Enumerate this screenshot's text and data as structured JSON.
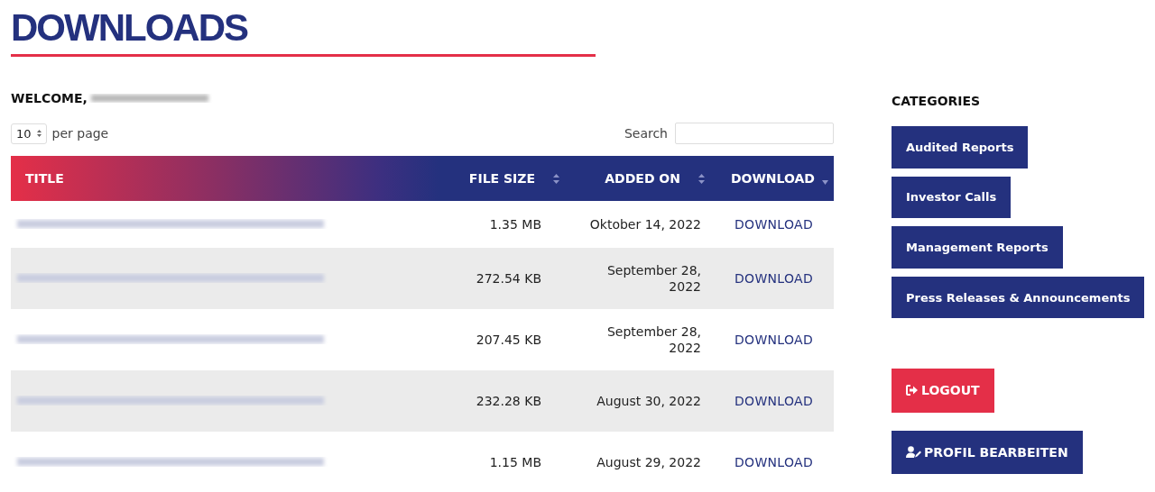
{
  "page_title": "DOWNLOADS",
  "welcome": {
    "label": "WELCOME,",
    "name_redacted": true
  },
  "per_page": {
    "value": "10",
    "label": "per page"
  },
  "search": {
    "label": "Search"
  },
  "table": {
    "columns": [
      {
        "label": "TITLE",
        "sortable": false,
        "sorted_desc": false
      },
      {
        "label": "FILE SIZE",
        "sortable": true,
        "sorted_desc": false
      },
      {
        "label": "ADDED ON",
        "sortable": true,
        "sorted_desc": false
      },
      {
        "label": "DOWNLOAD",
        "sortable": true,
        "sorted_desc": true
      }
    ],
    "rows": [
      {
        "title_redacted": true,
        "size": "1.35 MB",
        "date": "Oktober 14, 2022",
        "link": "DOWNLOAD"
      },
      {
        "title_redacted": true,
        "size": "272.54 KB",
        "date": "September 28, 2022",
        "link": "DOWNLOAD"
      },
      {
        "title_redacted": true,
        "size": "207.45 KB",
        "date": "September 28, 2022",
        "link": "DOWNLOAD"
      },
      {
        "title_redacted": true,
        "size": "232.28 KB",
        "date": "August 30, 2022",
        "link": "DOWNLOAD"
      },
      {
        "title_redacted": true,
        "size": "1.15 MB",
        "date": "August 29, 2022",
        "link": "DOWNLOAD"
      }
    ]
  },
  "categories": {
    "heading": "CATEGORIES",
    "items": [
      "Audited Reports",
      "Investor Calls",
      "Management Reports",
      "Press Releases & Announcements"
    ]
  },
  "buttons": [
    {
      "kind": "logout",
      "label": "LOGOUT"
    },
    {
      "kind": "profile",
      "label": "PROFIL BEARBEITEN"
    }
  ]
}
